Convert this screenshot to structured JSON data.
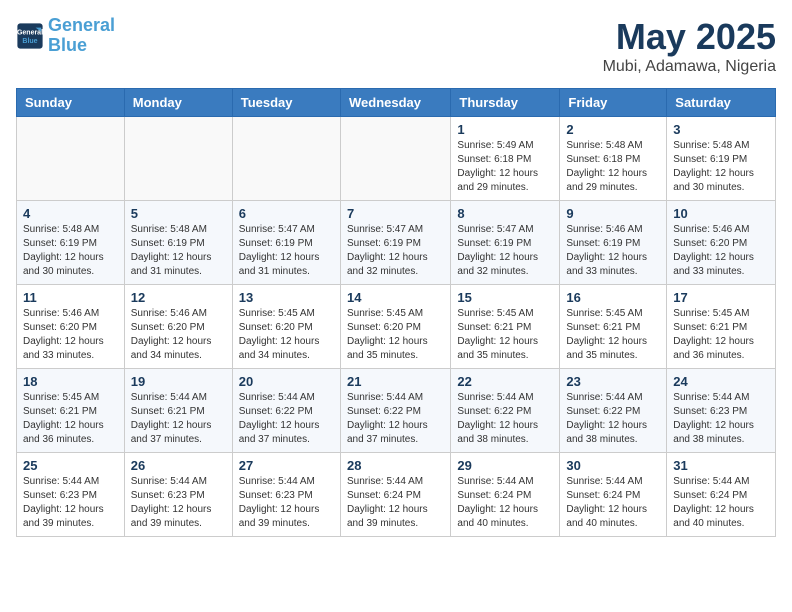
{
  "header": {
    "logo_line1": "General",
    "logo_line2": "Blue",
    "month": "May 2025",
    "location": "Mubi, Adamawa, Nigeria"
  },
  "weekdays": [
    "Sunday",
    "Monday",
    "Tuesday",
    "Wednesday",
    "Thursday",
    "Friday",
    "Saturday"
  ],
  "weeks": [
    [
      {
        "day": "",
        "info": ""
      },
      {
        "day": "",
        "info": ""
      },
      {
        "day": "",
        "info": ""
      },
      {
        "day": "",
        "info": ""
      },
      {
        "day": "1",
        "info": "Sunrise: 5:49 AM\nSunset: 6:18 PM\nDaylight: 12 hours\nand 29 minutes."
      },
      {
        "day": "2",
        "info": "Sunrise: 5:48 AM\nSunset: 6:18 PM\nDaylight: 12 hours\nand 29 minutes."
      },
      {
        "day": "3",
        "info": "Sunrise: 5:48 AM\nSunset: 6:19 PM\nDaylight: 12 hours\nand 30 minutes."
      }
    ],
    [
      {
        "day": "4",
        "info": "Sunrise: 5:48 AM\nSunset: 6:19 PM\nDaylight: 12 hours\nand 30 minutes."
      },
      {
        "day": "5",
        "info": "Sunrise: 5:48 AM\nSunset: 6:19 PM\nDaylight: 12 hours\nand 31 minutes."
      },
      {
        "day": "6",
        "info": "Sunrise: 5:47 AM\nSunset: 6:19 PM\nDaylight: 12 hours\nand 31 minutes."
      },
      {
        "day": "7",
        "info": "Sunrise: 5:47 AM\nSunset: 6:19 PM\nDaylight: 12 hours\nand 32 minutes."
      },
      {
        "day": "8",
        "info": "Sunrise: 5:47 AM\nSunset: 6:19 PM\nDaylight: 12 hours\nand 32 minutes."
      },
      {
        "day": "9",
        "info": "Sunrise: 5:46 AM\nSunset: 6:19 PM\nDaylight: 12 hours\nand 33 minutes."
      },
      {
        "day": "10",
        "info": "Sunrise: 5:46 AM\nSunset: 6:20 PM\nDaylight: 12 hours\nand 33 minutes."
      }
    ],
    [
      {
        "day": "11",
        "info": "Sunrise: 5:46 AM\nSunset: 6:20 PM\nDaylight: 12 hours\nand 33 minutes."
      },
      {
        "day": "12",
        "info": "Sunrise: 5:46 AM\nSunset: 6:20 PM\nDaylight: 12 hours\nand 34 minutes."
      },
      {
        "day": "13",
        "info": "Sunrise: 5:45 AM\nSunset: 6:20 PM\nDaylight: 12 hours\nand 34 minutes."
      },
      {
        "day": "14",
        "info": "Sunrise: 5:45 AM\nSunset: 6:20 PM\nDaylight: 12 hours\nand 35 minutes."
      },
      {
        "day": "15",
        "info": "Sunrise: 5:45 AM\nSunset: 6:21 PM\nDaylight: 12 hours\nand 35 minutes."
      },
      {
        "day": "16",
        "info": "Sunrise: 5:45 AM\nSunset: 6:21 PM\nDaylight: 12 hours\nand 35 minutes."
      },
      {
        "day": "17",
        "info": "Sunrise: 5:45 AM\nSunset: 6:21 PM\nDaylight: 12 hours\nand 36 minutes."
      }
    ],
    [
      {
        "day": "18",
        "info": "Sunrise: 5:45 AM\nSunset: 6:21 PM\nDaylight: 12 hours\nand 36 minutes."
      },
      {
        "day": "19",
        "info": "Sunrise: 5:44 AM\nSunset: 6:21 PM\nDaylight: 12 hours\nand 37 minutes."
      },
      {
        "day": "20",
        "info": "Sunrise: 5:44 AM\nSunset: 6:22 PM\nDaylight: 12 hours\nand 37 minutes."
      },
      {
        "day": "21",
        "info": "Sunrise: 5:44 AM\nSunset: 6:22 PM\nDaylight: 12 hours\nand 37 minutes."
      },
      {
        "day": "22",
        "info": "Sunrise: 5:44 AM\nSunset: 6:22 PM\nDaylight: 12 hours\nand 38 minutes."
      },
      {
        "day": "23",
        "info": "Sunrise: 5:44 AM\nSunset: 6:22 PM\nDaylight: 12 hours\nand 38 minutes."
      },
      {
        "day": "24",
        "info": "Sunrise: 5:44 AM\nSunset: 6:23 PM\nDaylight: 12 hours\nand 38 minutes."
      }
    ],
    [
      {
        "day": "25",
        "info": "Sunrise: 5:44 AM\nSunset: 6:23 PM\nDaylight: 12 hours\nand 39 minutes."
      },
      {
        "day": "26",
        "info": "Sunrise: 5:44 AM\nSunset: 6:23 PM\nDaylight: 12 hours\nand 39 minutes."
      },
      {
        "day": "27",
        "info": "Sunrise: 5:44 AM\nSunset: 6:23 PM\nDaylight: 12 hours\nand 39 minutes."
      },
      {
        "day": "28",
        "info": "Sunrise: 5:44 AM\nSunset: 6:24 PM\nDaylight: 12 hours\nand 39 minutes."
      },
      {
        "day": "29",
        "info": "Sunrise: 5:44 AM\nSunset: 6:24 PM\nDaylight: 12 hours\nand 40 minutes."
      },
      {
        "day": "30",
        "info": "Sunrise: 5:44 AM\nSunset: 6:24 PM\nDaylight: 12 hours\nand 40 minutes."
      },
      {
        "day": "31",
        "info": "Sunrise: 5:44 AM\nSunset: 6:24 PM\nDaylight: 12 hours\nand 40 minutes."
      }
    ]
  ]
}
